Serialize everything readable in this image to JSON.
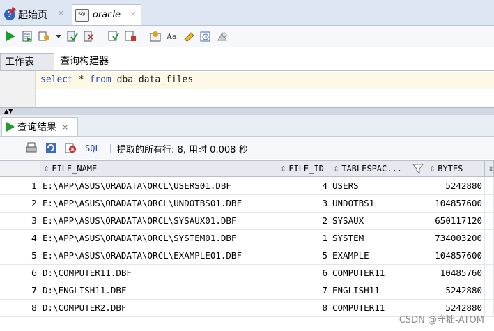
{
  "editor_tabs": [
    {
      "label": "起始页",
      "icon": "help-icon",
      "close": "×"
    },
    {
      "label": "oracle",
      "icon": "sql-worksheet-icon",
      "close": "×"
    }
  ],
  "worksheet_tabs": [
    "工作表",
    "查询构建器"
  ],
  "editor": {
    "code": [
      {
        "text": "select",
        "kind": "kw"
      },
      {
        "text": " * ",
        "kind": "tx"
      },
      {
        "text": "from",
        "kind": "kw"
      },
      {
        "text": " dba_data_files",
        "kind": "tx"
      }
    ]
  },
  "results_tab": {
    "label": "查询结果",
    "close": "×"
  },
  "results_toolbar": {
    "sql_label": "SQL",
    "status": "提取的所有行: 8, 用时 0.008 秒"
  },
  "table": {
    "columns": [
      "FILE_NAME",
      "FILE_ID",
      "TABLESPAC...",
      "BYTES"
    ],
    "rows": [
      {
        "num": "1",
        "file_name": "E:\\APP\\ASUS\\ORADATA\\ORCL\\USERS01.DBF",
        "file_id": "4",
        "tablespace": "USERS",
        "bytes": "5242880"
      },
      {
        "num": "2",
        "file_name": "E:\\APP\\ASUS\\ORADATA\\ORCL\\UNDOTBS01.DBF",
        "file_id": "3",
        "tablespace": "UNDOTBS1",
        "bytes": "104857600"
      },
      {
        "num": "3",
        "file_name": "E:\\APP\\ASUS\\ORADATA\\ORCL\\SYSAUX01.DBF",
        "file_id": "2",
        "tablespace": "SYSAUX",
        "bytes": "650117120"
      },
      {
        "num": "4",
        "file_name": "E:\\APP\\ASUS\\ORADATA\\ORCL\\SYSTEM01.DBF",
        "file_id": "1",
        "tablespace": "SYSTEM",
        "bytes": "734003200"
      },
      {
        "num": "5",
        "file_name": "E:\\APP\\ASUS\\ORADATA\\ORCL\\EXAMPLE01.DBF",
        "file_id": "5",
        "tablespace": "EXAMPLE",
        "bytes": "104857600"
      },
      {
        "num": "6",
        "file_name": "D:\\COMPUTER11.DBF",
        "file_id": "6",
        "tablespace": "COMPUTER11",
        "bytes": "10485760"
      },
      {
        "num": "7",
        "file_name": "D:\\ENGLISH11.DBF",
        "file_id": "7",
        "tablespace": "ENGLISH11",
        "bytes": "5242880"
      },
      {
        "num": "8",
        "file_name": "D:\\COMPUTER2.DBF",
        "file_id": "8",
        "tablespace": "COMPUTER11",
        "bytes": "5242880"
      }
    ]
  },
  "watermark": "CSDN @守拙-ATOM",
  "colors": {
    "keyword": "#2b49c8",
    "run_green": "#1e9d2a",
    "header_bg": "#e6e9ef"
  }
}
